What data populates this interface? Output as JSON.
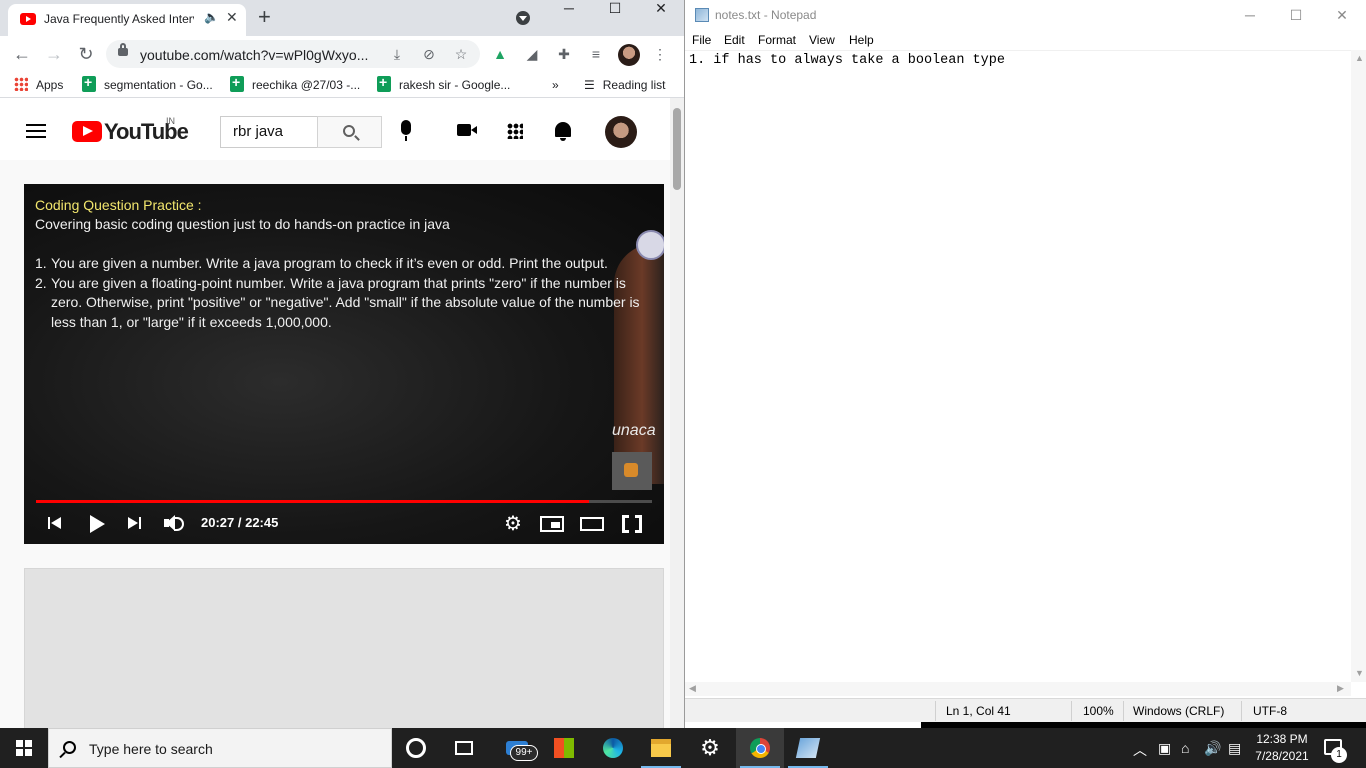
{
  "chrome": {
    "tab_title": "Java Frequently Asked Interv",
    "url": "youtube.com/watch?v=wPl0gWxyo...",
    "bookmarks": [
      {
        "label": "Apps"
      },
      {
        "label": "segmentation - Go..."
      },
      {
        "label": "reechika @27/03 -..."
      },
      {
        "label": "rakesh sir - Google..."
      }
    ],
    "bookmarks_overflow": "»",
    "reading_list": "Reading list"
  },
  "youtube": {
    "logo_text": "YouTube",
    "region": "IN",
    "search_value": "rbr java",
    "video": {
      "heading": "Coding Question Practice :",
      "subheading": "Covering basic coding question just to do hands-on practice in java",
      "items": [
        {
          "num": "1.",
          "text": "You are given a number. Write a java program to check if it’s even or odd. Print the output."
        },
        {
          "num": "2.",
          "text": "You are given a floating-point number. Write a java program that prints \"zero\" if the number is zero. Otherwise, print \"positive\" or \"negative\". Add \"small\" if the absolute value of the number is less than 1, or \"large\" if it exceeds 1,000,000."
        }
      ],
      "watermark": "unaca",
      "time": "20:27 / 22:45",
      "progress_fraction": 0.8974
    }
  },
  "notepad": {
    "title": "notes.txt - Notepad",
    "menu": [
      "File",
      "Edit",
      "Format",
      "View",
      "Help"
    ],
    "content": "1. if has to always take a boolean type",
    "status": {
      "position": "Ln 1, Col 41",
      "zoom": "100%",
      "line_ending": "Windows (CRLF)",
      "encoding": "UTF-8"
    }
  },
  "taskbar": {
    "search_placeholder": "Type here to search",
    "mail_badge": "99+",
    "time": "12:38 PM",
    "date": "7/28/2021",
    "notification_count": "1"
  },
  "colors": {
    "youtube_red": "#ff0000",
    "video_heading": "#f2e66d",
    "taskbar": "#202020"
  }
}
